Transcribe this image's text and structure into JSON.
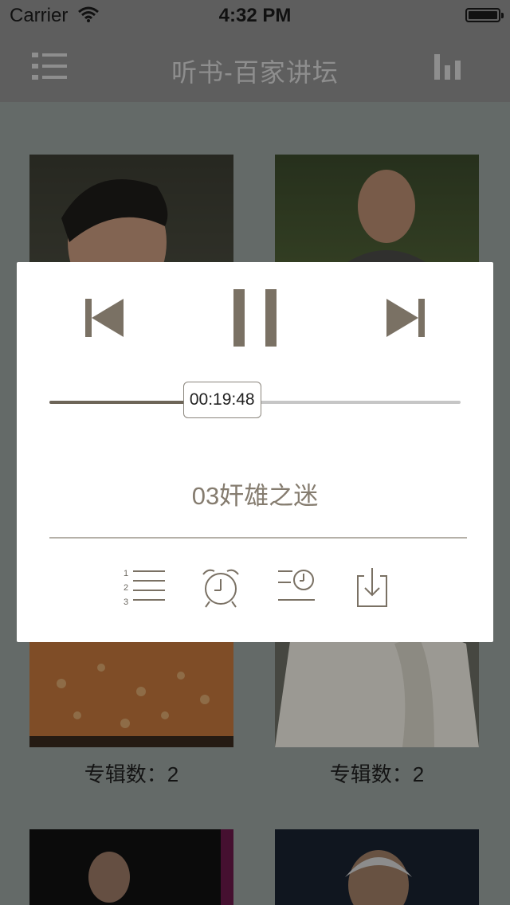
{
  "status_bar": {
    "carrier": "Carrier",
    "time": "4:32 PM"
  },
  "nav": {
    "title": "听书-百家讲坛",
    "left_icon": "list-menu-icon",
    "right_icon": "bar-chart-icon"
  },
  "cards": [
    {
      "caption": ""
    },
    {
      "caption": ""
    },
    {
      "caption": "专辑数：2"
    },
    {
      "caption": "专辑数：2"
    },
    {
      "caption": ""
    },
    {
      "caption": ""
    }
  ],
  "player": {
    "time": "00:19:48",
    "progress": 0.42,
    "track_title": "03奸雄之迷",
    "controls": [
      "previous-track-icon",
      "pause-icon",
      "next-track-icon"
    ],
    "tools": [
      "numbered-list-icon",
      "alarm-clock-icon",
      "sleep-timer-icon",
      "download-icon"
    ]
  },
  "colors": {
    "accent": "#7a7164",
    "bar": "#5e5e5e"
  }
}
